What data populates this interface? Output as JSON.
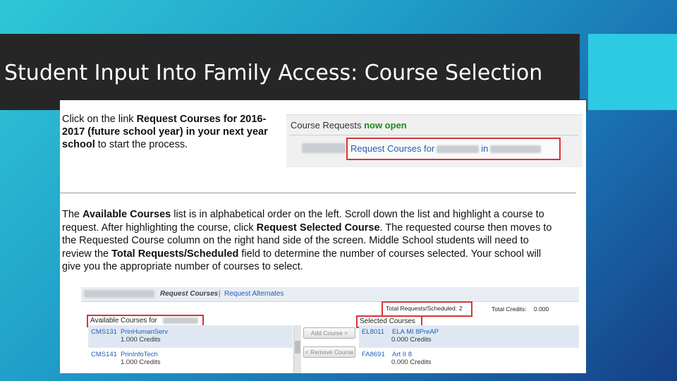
{
  "slide": {
    "title": "Student Input Into Family Access: Course Selection",
    "colors": {
      "title_bar": "#262626",
      "accent": "#2ec9e2",
      "highlight_box": "#d9343a",
      "link": "#1f5fb8",
      "open_status": "#1d8a1d"
    }
  },
  "instruction1": {
    "t1": "Click on the link ",
    "b1": "Request Courses for 2016-2017",
    "t2": "  ",
    "b2": "(future school year)",
    "t3": " ",
    "b3": "in your next year school",
    "t4": " to start the process."
  },
  "course_requests": {
    "heading": "Course Requests",
    "status": "now open",
    "link_prefix": "Request Courses for",
    "link_mid": "in"
  },
  "instruction2": {
    "t1": "The ",
    "b1": "Available Courses",
    "t2": " list is in alphabetical order on the left.  Scroll down the list and highlight a course to request.  After highlighting the course, click ",
    "b2": "Request Selected Course",
    "t3": ". The requested course then moves to the Requested Course column on the right hand side of the screen. Middle School students will need to review the ",
    "b3": "Total Requests/Scheduled",
    "t4": " field to determine the number of courses selected.  Your school will give you the appropriate number of courses to select."
  },
  "selection_ui": {
    "tab_request_courses": "Request Courses",
    "tab_separator": "|",
    "tab_request_alternates": "Request Alternates",
    "total_label": "Total Requests/Scheduled:",
    "total_value": "2",
    "credits_label": "Total Credits:",
    "credits_value": "0.000",
    "available_label": "Available Courses for",
    "selected_label": "Selected Courses",
    "add_button": "Add Course >",
    "remove_button": "< Remove Course",
    "available": [
      {
        "code": "CMS131",
        "name": "PrinHumanServ",
        "credits": "1.000 Credits"
      },
      {
        "code": "CMS141",
        "name": "PrinInfoTech",
        "credits": "1.000 Credits"
      }
    ],
    "selected": [
      {
        "code": "EL8011",
        "name": "ELA MI 8PreAP",
        "credits": "0.000 Credits"
      },
      {
        "code": "FA8691",
        "name": "Art II 8",
        "credits": "0.000 Credits"
      }
    ]
  }
}
